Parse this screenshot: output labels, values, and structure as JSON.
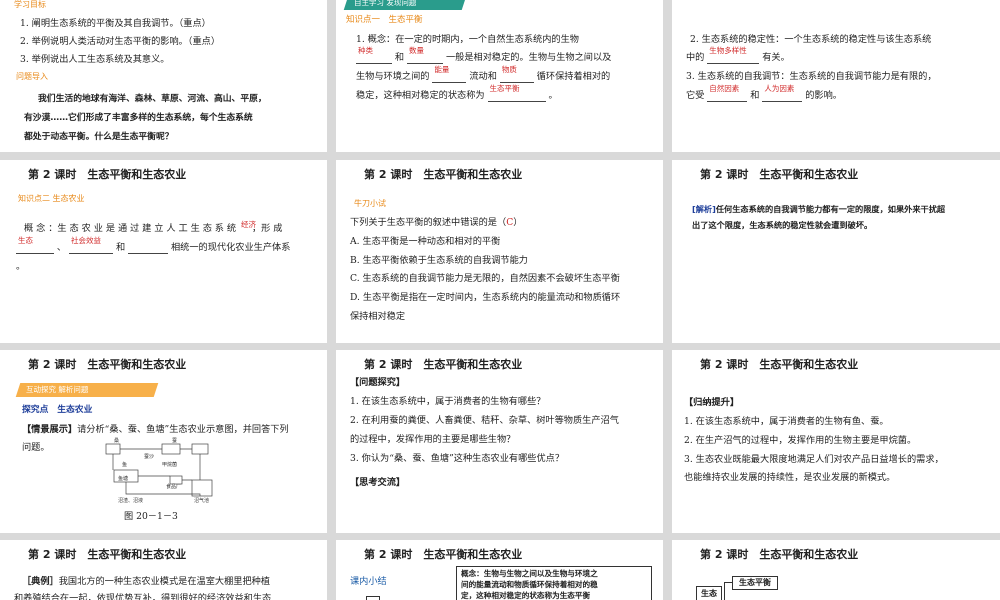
{
  "slide1": {
    "section_label": "学习目标",
    "objectives": [
      "1. 阐明生态系统的平衡及其自我调节。（重点）",
      "2. 举例说明人类活动对生态平衡的影响。（重点）",
      "3. 举例说出人工生态系统及其意义。"
    ],
    "intro_label": "问题导入",
    "intro_lines": [
      "我们生活的地球有海洋、森林、草原、河流、高山、平原，",
      "有沙漠……它们形成了丰富多样的生态系统，每个生态系统",
      "都处于动态平衡。什么是生态平衡呢？"
    ]
  },
  "slide2": {
    "banner": "自主学习 发现问题",
    "section": "知识点一　生态平衡",
    "p1a": "1. 概念：在一定的时期内，一个自然生态系统内的生物",
    "ans1": "种类",
    "p1b": "和",
    "ans2": "数量",
    "p1c": "一般是相对稳定的。生物与生物之间以及",
    "p1d": "生物与环境之间的",
    "ans3": "能量",
    "p1e": "流动和",
    "ans4": "物质",
    "p1f": "循环保持着相对的",
    "p1g": "稳定，这种相对稳定的状态称为",
    "ans5": "生态平衡",
    "p1h": "。"
  },
  "slide3": {
    "p2a": "2. 生态系统的稳定性：一个生态系统的稳定性与该生态系统",
    "p2b": "中的",
    "ans1": "生物多样性",
    "p2c": "有关。",
    "p3a": "3. 生态系统的自我调节：生态系统的自我调节能力是有限的，",
    "p3b": "它受",
    "ans2": "自然因素",
    "p3c": "和",
    "ans3": "人为因素",
    "p3d": "的影响。"
  },
  "slide4": {
    "title": "第 2 课时　生态平衡和生态农业",
    "section": "知识点二 生态农业",
    "p_a": "概 念 ：生 态 农 业 是 通 过 建 立 人 工 生 态 系 统",
    "ans1": "经济",
    "p_b": "，形 成",
    "ans2": "生态",
    "p_c": "、",
    "ans3": "社会效益",
    "p_d": "和",
    "p_e": "相统一的现代化农业生产体系",
    "p_f": "。"
  },
  "slide5": {
    "title": "第 2 课时　生态平衡和生态农业",
    "label": "牛刀小试",
    "question": "下列关于生态平衡的叙述中错误的是（",
    "answer": "C",
    "question_end": "）",
    "options": [
      "A. 生态平衡是一种动态和相对的平衡",
      "B. 生态平衡依赖于生态系统的自我调节能力",
      "C. 生态系统的自我调节能力是无限的，自然因素不会破坏生态平衡",
      "D. 生态平衡是指在一定时间内，生态系统内的能量流动和物质循环",
      "   保持相对稳定"
    ]
  },
  "slide6": {
    "title": "第 2 课时　生态平衡和生态农业",
    "tag": "[解析]",
    "lines": [
      "任何生态系统的自我调节能力都有一定的限度，如果外来干扰超",
      "出了这个限度，生态系统的稳定性就会遭到破坏。"
    ]
  },
  "slide7": {
    "title": "第 2 课时　生态平衡和生态农业",
    "banner": "互动探究 解析问题",
    "section": "探究点　生态农业",
    "scene_tag": "【情景展示】",
    "scene_lines": [
      "请分析“桑、蚕、鱼塘”生态农业示意图，并回答下列",
      "问题。"
    ],
    "diagram_labels": [
      "桑",
      "蚕",
      "蚕沙",
      "鱼",
      "鱼塘",
      "甲烷菌",
      "沼渣、沼液",
      "食品厂",
      "沼气池"
    ],
    "caption": "图 20－1－3"
  },
  "slide8": {
    "title": "第 2 课时　生态平衡和生态农业",
    "tag": "【问题探究】",
    "questions": [
      "1. 在该生态系统中，属于消费者的生物有哪些？",
      "2. 在利用蚕的粪便、人畜粪便、秸秆、杂草、树叶等物质生产沼气",
      "   的过程中，发挥作用的主要是哪些生物？",
      "3. 你认为“桑、蚕、鱼塘”这种生态农业有哪些优点？"
    ],
    "tag2": "【思考交流】"
  },
  "slide9": {
    "title": "第 2 课时　生态平衡和生态农业",
    "tag": "【归纳提升】",
    "lines": [
      "1. 在该生态系统中，属于消费者的生物有鱼、蚕。",
      "2. 在生产沼气的过程中，发挥作用的生物主要是甲烷菌。",
      "3. 生态农业既能最大限度地满足人们对农产品日益增长的需求，",
      "   也能维持农业发展的持续性，是农业发展的新模式。"
    ]
  },
  "slide10": {
    "title": "第 2 课时　生态平衡和生态农业",
    "tag": "［典例］",
    "lines": [
      "我国北方的一种生态农业模式是在温室大棚里把种植",
      "和养殖结合在一起，依现优势互补，得到很好的经济效益和生态"
    ]
  },
  "slide11": {
    "title": "第 2 课时　生态平衡和生态农业",
    "label": "课内小结",
    "box_lines": [
      "概念：生物与生物之间以及生物与环境之",
      "间的能量流动和物质循环保持着相对的稳",
      "定，这种相对稳定的状态称为生态平衡"
    ]
  },
  "slide12": {
    "title": "第 2 课时　生态平衡和生态农业",
    "box1": "生态平衡",
    "box2": "生态"
  }
}
